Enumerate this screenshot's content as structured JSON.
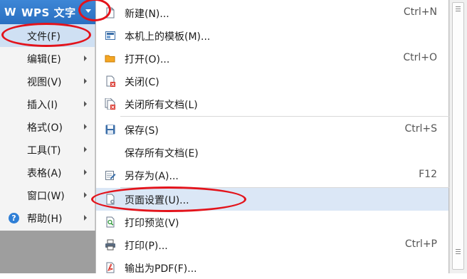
{
  "header": {
    "logo": "W",
    "title": "WPS 文字"
  },
  "left_menu": {
    "items": [
      {
        "label": "文件(F)",
        "selected": true,
        "has_submenu": false
      },
      {
        "label": "编辑(E)",
        "has_submenu": true
      },
      {
        "label": "视图(V)",
        "has_submenu": true
      },
      {
        "label": "插入(I)",
        "has_submenu": true
      },
      {
        "label": "格式(O)",
        "has_submenu": true
      },
      {
        "label": "工具(T)",
        "has_submenu": true
      },
      {
        "label": "表格(A)",
        "has_submenu": true
      },
      {
        "label": "窗口(W)",
        "has_submenu": true
      },
      {
        "label": "帮助(H)",
        "has_submenu": true,
        "icon": "help-icon"
      }
    ]
  },
  "file_menu": {
    "items": [
      {
        "label": "新建(N)...",
        "shortcut": "Ctrl+N",
        "icon": "new-document-icon"
      },
      {
        "label": "本机上的模板(M)...",
        "shortcut": "",
        "icon": "template-icon"
      },
      {
        "label": "打开(O)...",
        "shortcut": "Ctrl+O",
        "icon": "open-folder-icon"
      },
      {
        "label": "关闭(C)",
        "shortcut": "",
        "icon": "close-document-icon"
      },
      {
        "label": "关闭所有文档(L)",
        "shortcut": "",
        "icon": "close-all-icon"
      },
      {
        "label": "保存(S)",
        "shortcut": "Ctrl+S",
        "icon": "save-icon"
      },
      {
        "label": "保存所有文档(E)",
        "shortcut": "",
        "icon": ""
      },
      {
        "label": "另存为(A)...",
        "shortcut": "F12",
        "icon": "save-as-icon"
      },
      {
        "label": "页面设置(U)...",
        "shortcut": "",
        "icon": "page-setup-icon",
        "hover": true
      },
      {
        "label": "打印预览(V)",
        "shortcut": "",
        "icon": "print-preview-icon"
      },
      {
        "label": "打印(P)...",
        "shortcut": "Ctrl+P",
        "icon": "printer-icon"
      },
      {
        "label": "输出为PDF(F)...",
        "shortcut": "",
        "icon": "pdf-export-icon"
      }
    ]
  },
  "colors": {
    "accent": "#2a6fc0",
    "selected_bg": "#cfe0f3",
    "hover_bg": "#dbe7f6",
    "annotation": "#e3131b"
  }
}
